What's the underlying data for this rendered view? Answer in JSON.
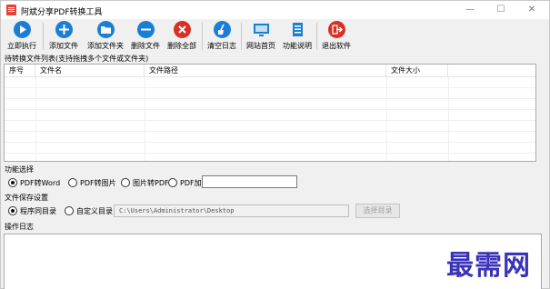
{
  "window": {
    "title": "阿斌分享PDF转换工具",
    "controls": {
      "minimize": "—",
      "maximize": "☐",
      "close": "✕"
    }
  },
  "toolbar": {
    "buttons": [
      {
        "label": "立即执行",
        "icon": "play-icon",
        "color": "#1a7fd4"
      },
      {
        "label": "添加文件",
        "icon": "plus-icon",
        "color": "#1a7fd4"
      },
      {
        "label": "添加文件夹",
        "icon": "folder-icon",
        "color": "#1a7fd4"
      },
      {
        "label": "删除文件",
        "icon": "minus-icon",
        "color": "#1a7fd4"
      },
      {
        "label": "删除全部",
        "icon": "close-icon",
        "color": "#d93025"
      },
      {
        "label": "清空日志",
        "icon": "broom-icon",
        "color": "#1a7fd4"
      },
      {
        "label": "网站首页",
        "icon": "monitor-icon",
        "color": "#1a7fd4"
      },
      {
        "label": "功能说明",
        "icon": "document-icon",
        "color": "#1a7fd4"
      },
      {
        "label": "退出软件",
        "icon": "exit-icon",
        "color": "#d93025"
      }
    ]
  },
  "file_list": {
    "title": "待转换文件列表(支持拖拽多个文件或文件夹)",
    "columns": [
      "序号",
      "文件名",
      "文件路径",
      "文件大小"
    ],
    "rows": []
  },
  "function_select": {
    "title": "功能选择",
    "options": [
      {
        "label": "PDF转Word",
        "checked": true
      },
      {
        "label": "PDF转图片",
        "checked": false
      },
      {
        "label": "图片转PDF",
        "checked": false
      },
      {
        "label": "PDF加密",
        "checked": false
      }
    ],
    "password_value": ""
  },
  "save_settings": {
    "title": "文件保存设置",
    "options": [
      {
        "label": "程序同目录",
        "checked": true
      },
      {
        "label": "自定义目录",
        "checked": false
      }
    ],
    "path_value": "C:\\Users\\Administrator\\Desktop",
    "choose_button": "选择目录"
  },
  "log": {
    "title": "操作日志",
    "content": ""
  },
  "watermark": {
    "text": "最需网",
    "color": "#3a33b8"
  }
}
